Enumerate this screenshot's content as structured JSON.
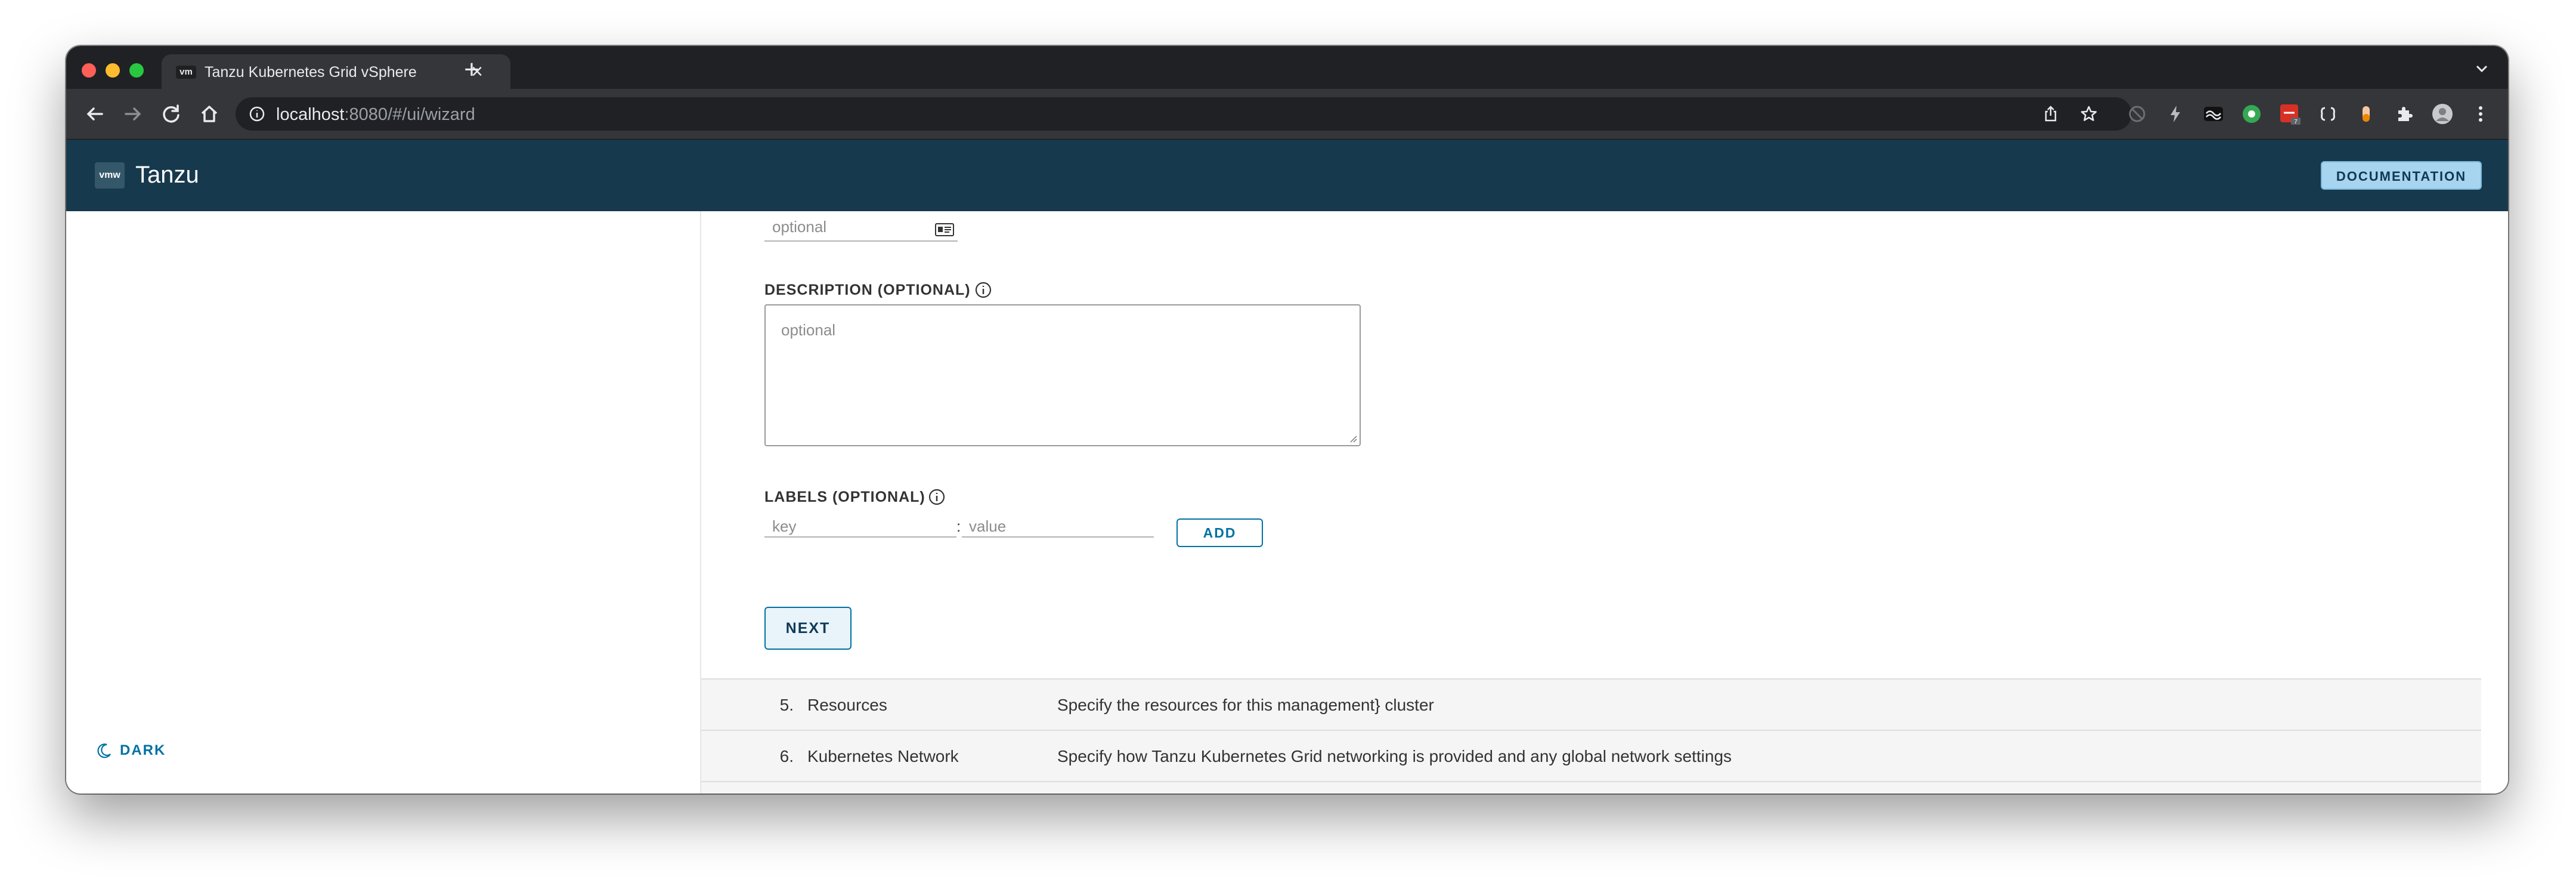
{
  "browser": {
    "tab": {
      "favicon_text": "vm",
      "title": "Tanzu Kubernetes Grid vSphere"
    },
    "url": {
      "host": "localhost",
      "rest": ":8080/#/ui/wizard"
    },
    "extensions": [
      "share-icon",
      "bookmark-star-icon",
      "blocked-extension-icon",
      "lightning-extension-icon",
      "wave-extension-icon",
      "green-extension-icon",
      "red-extension-icon",
      "code-extension-icon",
      "pill-extension-icon",
      "puzzle-extension-icon",
      "profile-avatar",
      "menu-dots-icon"
    ],
    "red_extension_badge": "7"
  },
  "app": {
    "logo": "vmw",
    "brand": "Tanzu",
    "documentation_label": "DOCUMENTATION",
    "dark_toggle_label": "DARK"
  },
  "form": {
    "name_placeholder": "optional",
    "description": {
      "label": "DESCRIPTION (OPTIONAL)",
      "placeholder": "optional"
    },
    "labels": {
      "label": "LABELS (OPTIONAL)",
      "key_placeholder": "key",
      "separator": ":",
      "value_placeholder": "value",
      "add_label": "ADD"
    },
    "next_label": "NEXT"
  },
  "steps": [
    {
      "num": "5.",
      "name": "Resources",
      "description": "Specify the resources for this management} cluster"
    },
    {
      "num": "6.",
      "name": "Kubernetes Network",
      "description": "Specify how Tanzu Kubernetes Grid networking is provided and any global network settings"
    }
  ],
  "colors": {
    "header_bg": "#17394d",
    "accent": "#0072a3",
    "doc_button_bg": "#a7d4ef"
  }
}
